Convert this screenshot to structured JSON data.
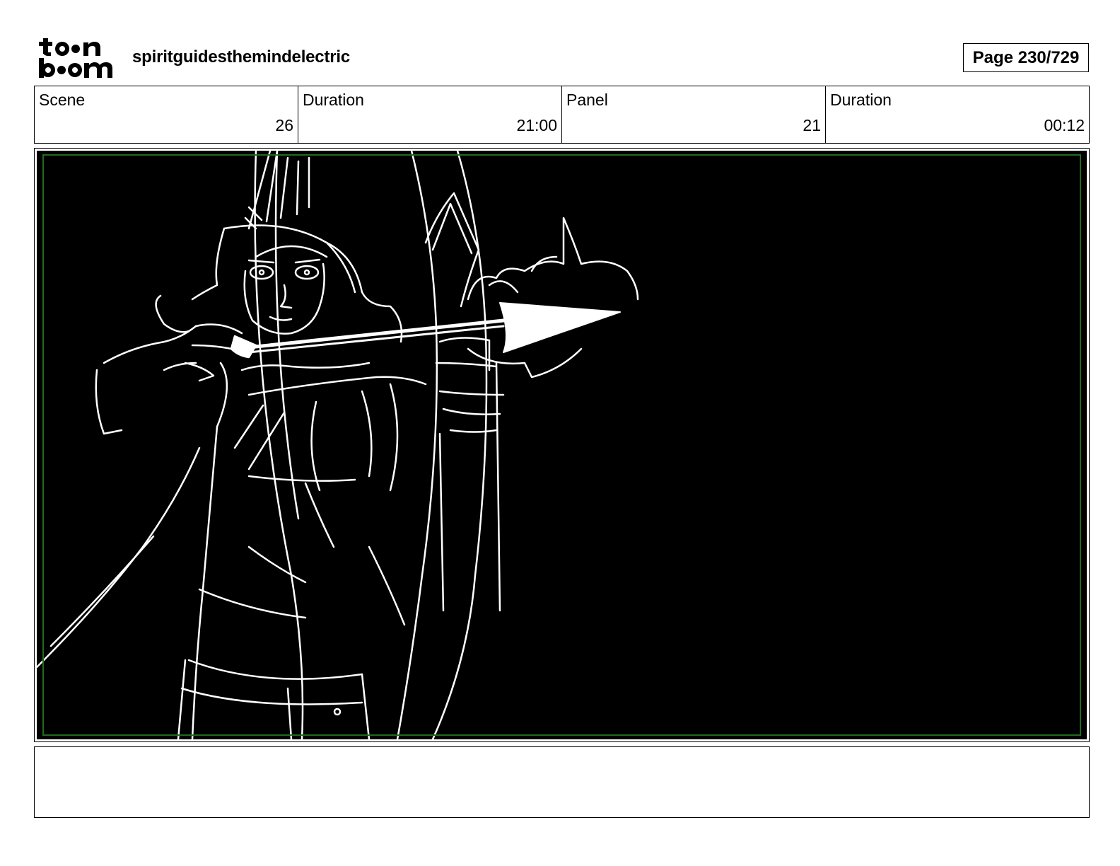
{
  "header": {
    "logo_text_top": "toon",
    "logo_text_bottom": "boom",
    "project_title": "spiritguidesthemindelectric",
    "page_label": "Page 230/729"
  },
  "info": [
    {
      "label": "Scene",
      "value": "26"
    },
    {
      "label": "Duration",
      "value": "21:00"
    },
    {
      "label": "Panel",
      "value": "21"
    },
    {
      "label": "Duration",
      "value": "00:12"
    }
  ],
  "panel": {
    "background_color": "#000000",
    "line_color": "#ffffff",
    "safe_frame_color": "#1f6b1f",
    "subject": "archer-drawing-bow-sketch"
  },
  "notes": {
    "text": ""
  }
}
